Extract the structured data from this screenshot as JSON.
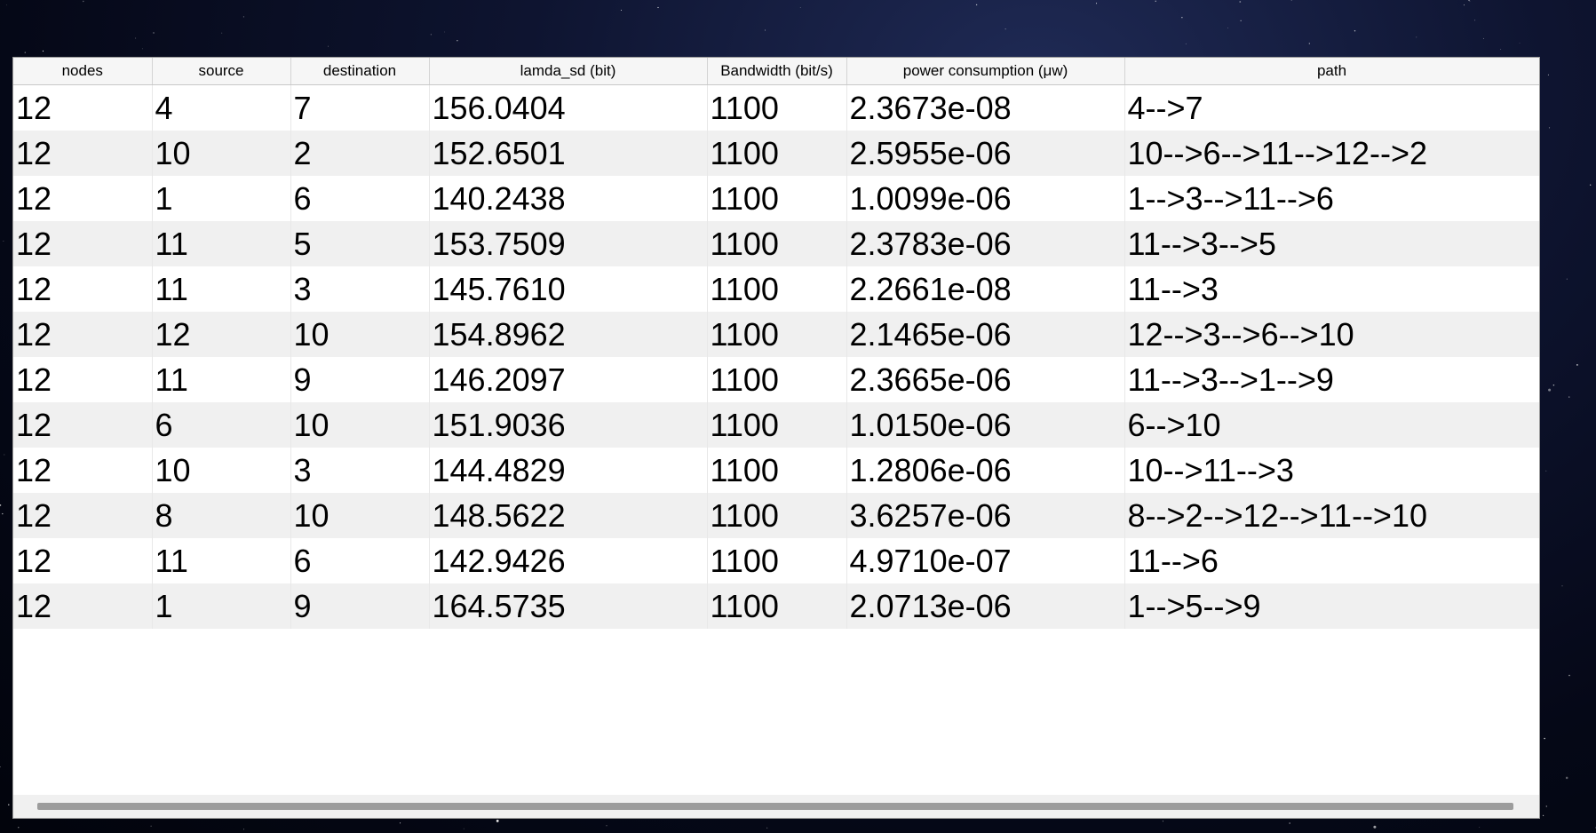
{
  "table": {
    "columns": [
      "nodes",
      "source",
      "destination",
      "lamda_sd (bit)",
      "Bandwidth (bit/s)",
      "power consumption (μw)",
      "path"
    ],
    "rows": [
      [
        "12",
        "4",
        "7",
        "156.0404",
        "1100",
        "2.3673e-08",
        "4-->7"
      ],
      [
        "12",
        "10",
        "2",
        "152.6501",
        "1100",
        "2.5955e-06",
        "10-->6-->11-->12-->2"
      ],
      [
        "12",
        "1",
        "6",
        "140.2438",
        "1100",
        "1.0099e-06",
        "1-->3-->11-->6"
      ],
      [
        "12",
        "11",
        "5",
        "153.7509",
        "1100",
        "2.3783e-06",
        "11-->3-->5"
      ],
      [
        "12",
        "11",
        "3",
        "145.7610",
        "1100",
        "2.2661e-08",
        "11-->3"
      ],
      [
        "12",
        "12",
        "10",
        "154.8962",
        "1100",
        "2.1465e-06",
        "12-->3-->6-->10"
      ],
      [
        "12",
        "11",
        "9",
        "146.2097",
        "1100",
        "2.3665e-06",
        "11-->3-->1-->9"
      ],
      [
        "12",
        "6",
        "10",
        "151.9036",
        "1100",
        "1.0150e-06",
        "6-->10"
      ],
      [
        "12",
        "10",
        "3",
        "144.4829",
        "1100",
        "1.2806e-06",
        "10-->11-->3"
      ],
      [
        "12",
        "8",
        "10",
        "148.5622",
        "1100",
        "3.6257e-06",
        "8-->2-->12-->11-->10"
      ],
      [
        "12",
        "11",
        "6",
        "142.9426",
        "1100",
        "4.9710e-07",
        "11-->6"
      ],
      [
        "12",
        "1",
        "9",
        "164.5735",
        "1100",
        "2.0713e-06",
        "1-->5-->9"
      ]
    ]
  },
  "colors": {
    "header_bg": "#f6f6f6",
    "row_even": "#ffffff",
    "row_odd": "#f0f0f0",
    "scrollbar_thumb": "#9c9c9c"
  }
}
